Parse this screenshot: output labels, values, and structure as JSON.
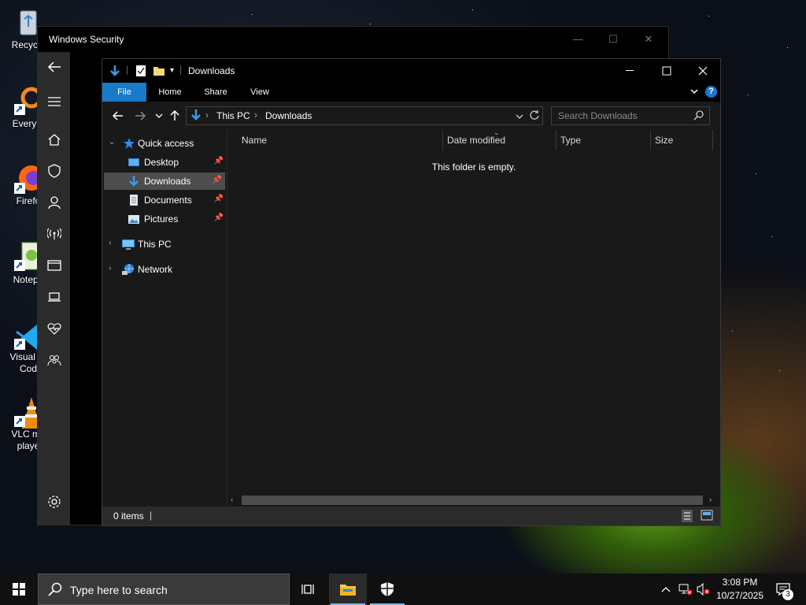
{
  "desktop": {
    "icons": [
      {
        "label": "Recycle",
        "icon": "recycle-bin-icon"
      },
      {
        "label": "Everyth",
        "icon": "everything-icon"
      },
      {
        "label": "Firefo",
        "icon": "firefox-icon"
      },
      {
        "label": "Notepa",
        "icon": "notepad-icon"
      },
      {
        "label": "Visual St Cod",
        "line1": "Visual St",
        "line2": "Cod",
        "icon": "vscode-icon"
      },
      {
        "label": "VLC me playe",
        "line1": "VLC me",
        "line2": "playe",
        "icon": "vlc-icon"
      }
    ]
  },
  "security_window": {
    "title": "Windows Security",
    "rail_icons": [
      "back-icon",
      "menu-icon",
      "home-icon",
      "shield-icon",
      "account-icon",
      "network-icon",
      "app-browser-icon",
      "device-security-icon",
      "health-icon",
      "family-icon",
      "settings-icon"
    ]
  },
  "explorer": {
    "title": "Downloads",
    "ribbon_tabs": [
      "File",
      "Home",
      "Share",
      "View"
    ],
    "address": {
      "root": "This PC",
      "current": "Downloads"
    },
    "search_placeholder": "Search Downloads",
    "nav": {
      "quick_access": "Quick access",
      "items": [
        {
          "label": "Desktop",
          "pinned": true
        },
        {
          "label": "Downloads",
          "pinned": true,
          "selected": true
        },
        {
          "label": "Documents",
          "pinned": true
        },
        {
          "label": "Pictures",
          "pinned": true
        }
      ],
      "this_pc": "This PC",
      "network": "Network"
    },
    "columns": [
      "Name",
      "Date modified",
      "Type",
      "Size"
    ],
    "empty_message": "This folder is empty.",
    "status": "0 items"
  },
  "taskbar": {
    "search_placeholder": "Type here to search",
    "time": "3:08 PM",
    "date": "10/27/2025",
    "notification_count": "3"
  },
  "colors": {
    "accent": "#1979ca",
    "selection": "#4d4d4d",
    "active_indicator": "#76b9ed"
  }
}
